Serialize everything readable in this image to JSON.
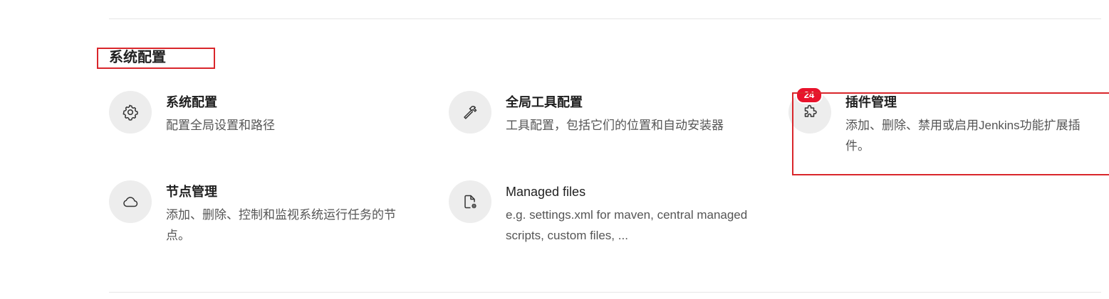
{
  "section": {
    "title": "系统配置"
  },
  "items": [
    {
      "title": "系统配置",
      "description": "配置全局设置和路径",
      "icon": "gear-icon"
    },
    {
      "title": "全局工具配置",
      "description": "工具配置，包括它们的位置和自动安装器",
      "icon": "hammer-icon"
    },
    {
      "title": "插件管理",
      "description": "添加、删除、禁用或启用Jenkins功能扩展插件。",
      "icon": "puzzle-icon",
      "badge": "24"
    },
    {
      "title": "节点管理",
      "description": "添加、删除、控制和监视系统运行任务的节点。",
      "icon": "cloud-icon"
    },
    {
      "title": "Managed files",
      "description": "e.g. settings.xml for maven, central managed scripts, custom files, ...",
      "icon": "file-gear-icon"
    }
  ],
  "colors": {
    "highlight": "#d9262b",
    "badge": "#e8132c",
    "icon_bg": "#ededed"
  }
}
